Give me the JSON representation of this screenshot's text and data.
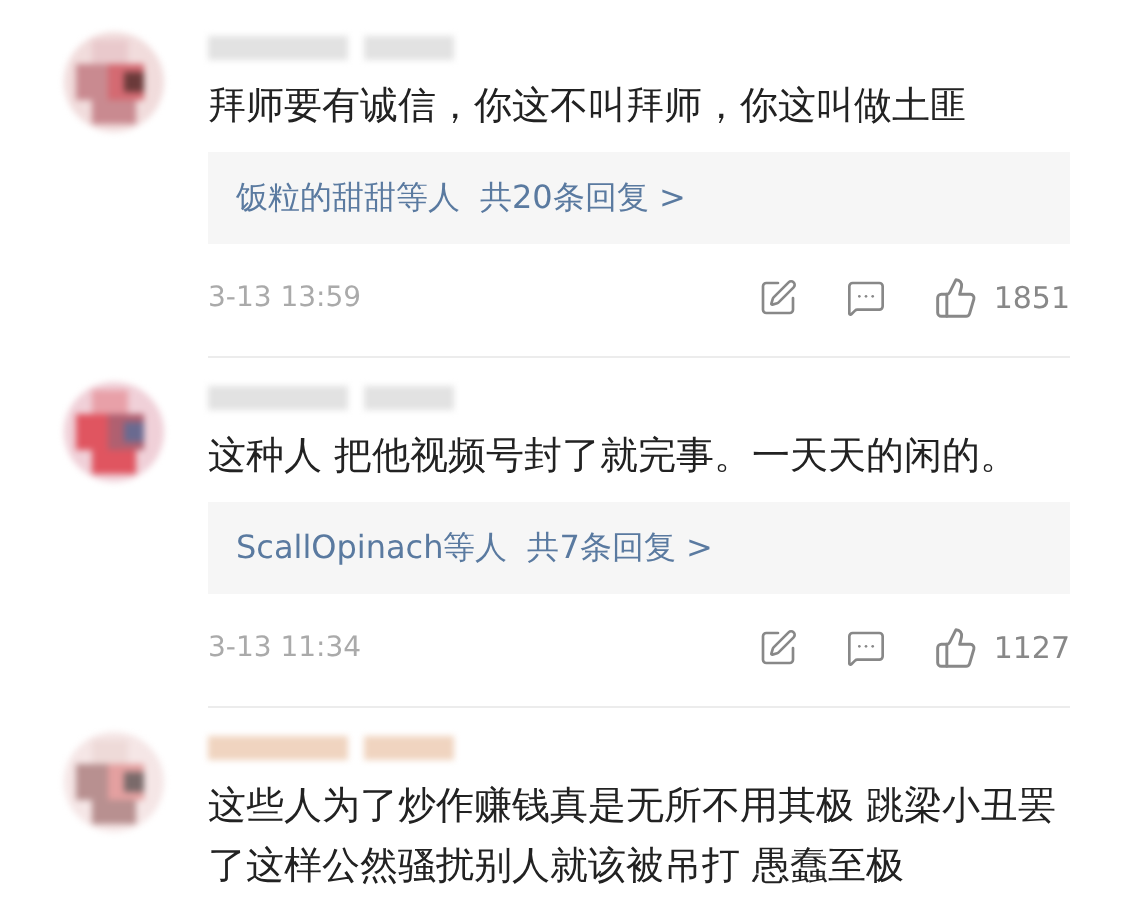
{
  "comments": [
    {
      "text": "拜师要有诚信，你这不叫拜师，你这叫做土匪",
      "replies": {
        "names": "饭粒的甜甜等人",
        "count": "共20条回复 >"
      },
      "time": "3-13 13:59",
      "likes": "1851"
    },
    {
      "text": "这种人 把他视频号封了就完事。一天天的闲的。",
      "replies": {
        "names": "ScallOpinach等人",
        "count": "共7条回复 >"
      },
      "time": "3-13 11:34",
      "likes": "1127"
    },
    {
      "text": "这些人为了炒作赚钱真是无所不用其极 跳梁小丑罢了这样公然骚扰别人就该被吊打 愚蠢至极"
    }
  ]
}
